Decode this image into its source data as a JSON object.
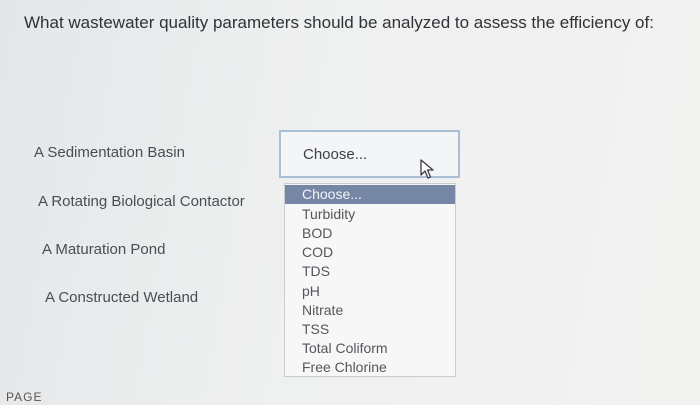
{
  "question": "What wastewater quality parameters should be analyzed to assess the efficiency of:",
  "rows": [
    {
      "label": "A Sedimentation Basin"
    },
    {
      "label": "A Rotating Biological Contactor"
    },
    {
      "label": "A Maturation Pond"
    },
    {
      "label": "A Constructed Wetland"
    }
  ],
  "select": {
    "value": "Choose..."
  },
  "dropdown": {
    "options": [
      "Choose...",
      "Turbidity",
      "BOD",
      "COD",
      "TDS",
      "pH",
      "Nitrate",
      "TSS",
      "Total Coliform",
      "Free Chlorine"
    ],
    "selected_index": 0,
    "highlight_color": "#7687a5"
  },
  "footer": {
    "text": "PAGE"
  },
  "icons": {
    "cursor": "mouse-pointer-icon"
  }
}
